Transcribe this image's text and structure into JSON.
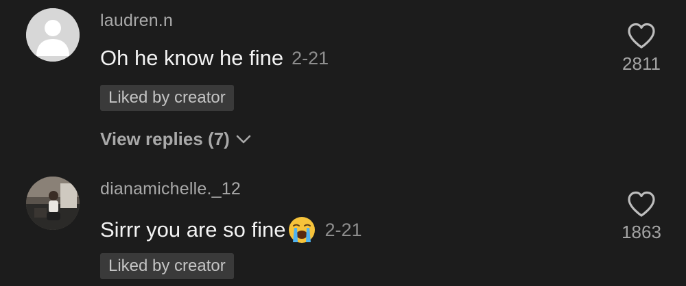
{
  "comments": [
    {
      "username": "laudren.n",
      "text": "Oh he know he fine",
      "date": "2-21",
      "badge": "Liked by creator",
      "like_count": "2811",
      "view_replies": "View replies (7)",
      "avatar": "default-user-avatar"
    },
    {
      "username": "dianamichelle._12",
      "text": "Sirrr you are so fine",
      "date": "2-21",
      "badge": "Liked by creator",
      "like_count": "1863",
      "emoji": "loudly-crying-face",
      "avatar": "user-photo-avatar"
    }
  ],
  "colors": {
    "background": "#1c1c1c",
    "username": "#a9a9a9",
    "text": "#f3f3f3",
    "date": "#8e8e8e",
    "badge_bg": "#3a3a3a",
    "badge_text": "#c4c4c4"
  },
  "icons": {
    "like": "heart-outline-icon",
    "expand": "chevron-down-icon"
  }
}
